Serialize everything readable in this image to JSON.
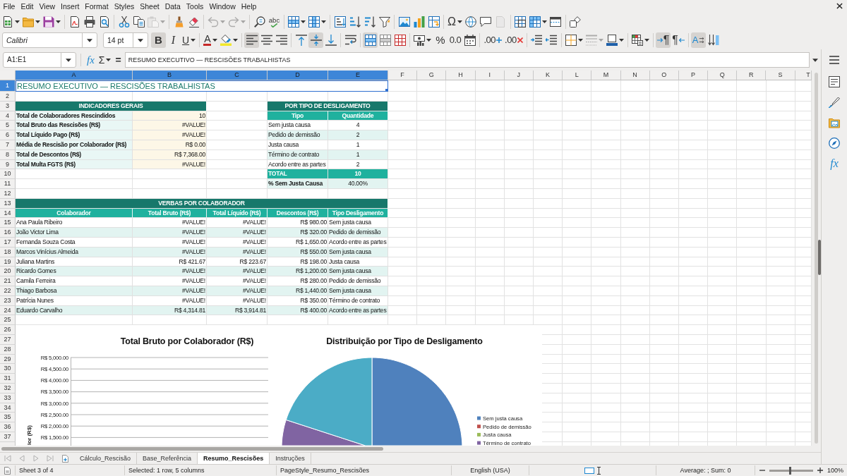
{
  "menu": [
    "File",
    "Edit",
    "View",
    "Insert",
    "Format",
    "Styles",
    "Sheet",
    "Data",
    "Tools",
    "Window",
    "Help"
  ],
  "standard_toolbar": {
    "groups": [
      {
        "items": [
          {
            "kind": "new",
            "dropdown": true,
            "disabled": false,
            "pressed": false
          },
          {
            "kind": "open",
            "dropdown": true,
            "disabled": false,
            "pressed": false
          },
          {
            "kind": "save",
            "dropdown": true,
            "disabled": false,
            "pressed": false
          }
        ]
      },
      {
        "items": [
          {
            "kind": "export_pdf",
            "dropdown": false,
            "disabled": false,
            "pressed": false
          },
          {
            "kind": "print",
            "dropdown": false,
            "disabled": false,
            "pressed": false
          },
          {
            "kind": "print_preview",
            "dropdown": false,
            "disabled": false,
            "pressed": false
          }
        ]
      },
      {
        "items": [
          {
            "kind": "cut",
            "dropdown": false,
            "disabled": false,
            "pressed": false
          },
          {
            "kind": "copy",
            "dropdown": false,
            "disabled": false,
            "pressed": false
          },
          {
            "kind": "paste",
            "dropdown": true,
            "disabled": true,
            "pressed": false
          }
        ]
      },
      {
        "items": [
          {
            "kind": "clone",
            "dropdown": false,
            "disabled": false,
            "pressed": false
          },
          {
            "kind": "clear_format",
            "dropdown": false,
            "disabled": false,
            "pressed": false
          }
        ]
      },
      {
        "items": [
          {
            "kind": "undo",
            "dropdown": true,
            "disabled": true,
            "pressed": false
          },
          {
            "kind": "redo",
            "dropdown": true,
            "disabled": true,
            "pressed": false
          }
        ]
      },
      {
        "items": [
          {
            "kind": "find_replace",
            "dropdown": false,
            "disabled": false,
            "pressed": false
          },
          {
            "kind": "spelling",
            "glyph": "abc",
            "dropdown": false,
            "disabled": false,
            "pressed": false
          }
        ]
      },
      {
        "items": [
          {
            "kind": "row",
            "dropdown": true,
            "disabled": false,
            "pressed": false
          },
          {
            "kind": "column",
            "dropdown": true,
            "disabled": false,
            "pressed": false
          }
        ]
      },
      {
        "items": [
          {
            "kind": "sort",
            "dropdown": false,
            "disabled": false,
            "pressed": false
          },
          {
            "kind": "sort_ascending",
            "dropdown": false,
            "disabled": false,
            "pressed": false
          },
          {
            "kind": "sort_descending",
            "dropdown": false,
            "disabled": false,
            "pressed": false
          },
          {
            "kind": "autofilter",
            "dropdown": false,
            "disabled": false,
            "pressed": false
          }
        ]
      },
      {
        "items": [
          {
            "kind": "image",
            "dropdown": false,
            "disabled": false,
            "pressed": false
          },
          {
            "kind": "chart",
            "dropdown": false,
            "disabled": false,
            "pressed": false
          },
          {
            "kind": "pivot_table",
            "dropdown": false,
            "disabled": false,
            "pressed": false
          }
        ]
      },
      {
        "items": [
          {
            "kind": "special_character",
            "glyph": "Ω",
            "dropdown": true,
            "disabled": false,
            "pressed": false
          },
          {
            "kind": "hyperlink",
            "dropdown": false,
            "disabled": false,
            "pressed": false
          },
          {
            "kind": "comment",
            "dropdown": false,
            "disabled": false,
            "pressed": false
          },
          {
            "kind": "header_footer",
            "dropdown": false,
            "disabled": true,
            "pressed": false
          }
        ]
      },
      {
        "items": [
          {
            "kind": "print_area",
            "dropdown": false,
            "disabled": false,
            "pressed": false
          },
          {
            "kind": "freeze",
            "dropdown": true,
            "disabled": false,
            "pressed": false
          },
          {
            "kind": "split_window",
            "dropdown": false,
            "disabled": false,
            "pressed": false
          }
        ]
      },
      {
        "items": [
          {
            "kind": "shapes",
            "dropdown": false,
            "disabled": false,
            "pressed": false
          }
        ]
      }
    ]
  },
  "formatting_toolbar": {
    "font_name": "Calibri",
    "font_size": "14 pt",
    "groups": [
      {
        "items": [
          {
            "kind": "bold",
            "glyph": "B",
            "dropdown": false,
            "disabled": false,
            "pressed": true
          },
          {
            "kind": "italic",
            "glyph": "I",
            "dropdown": false,
            "disabled": false,
            "pressed": false
          },
          {
            "kind": "underline",
            "glyph": "U",
            "dropdown": true,
            "disabled": false,
            "pressed": false
          }
        ]
      },
      {
        "items": [
          {
            "kind": "font_color",
            "glyph": "A",
            "dropdown": true,
            "disabled": false,
            "pressed": false
          },
          {
            "kind": "highlight",
            "dropdown": true,
            "disabled": false,
            "pressed": false
          }
        ]
      },
      {
        "items": [
          {
            "kind": "align_left",
            "dropdown": false,
            "disabled": false,
            "pressed": true
          },
          {
            "kind": "align_center",
            "dropdown": false,
            "disabled": false,
            "pressed": false
          },
          {
            "kind": "align_right",
            "dropdown": false,
            "disabled": false,
            "pressed": false
          }
        ]
      },
      {
        "items": [
          {
            "kind": "align_top",
            "dropdown": false,
            "disabled": false,
            "pressed": false
          },
          {
            "kind": "align_middle",
            "dropdown": false,
            "disabled": false,
            "pressed": true
          },
          {
            "kind": "align_bottom",
            "dropdown": false,
            "disabled": false,
            "pressed": false
          }
        ]
      },
      {
        "items": [
          {
            "kind": "wrap_text",
            "dropdown": false,
            "disabled": false,
            "pressed": false
          }
        ]
      },
      {
        "items": [
          {
            "kind": "merge_center",
            "dropdown": false,
            "disabled": false,
            "pressed": true
          },
          {
            "kind": "merge",
            "dropdown": false,
            "disabled": false,
            "pressed": false
          },
          {
            "kind": "unmerge",
            "dropdown": false,
            "disabled": false,
            "pressed": false
          }
        ]
      },
      {
        "items": [
          {
            "kind": "currency",
            "dropdown": true,
            "disabled": false,
            "pressed": false
          },
          {
            "kind": "percent",
            "glyph": "%",
            "dropdown": false,
            "disabled": false,
            "pressed": false
          },
          {
            "kind": "number",
            "glyph": "0.0",
            "dropdown": false,
            "disabled": false,
            "pressed": false
          },
          {
            "kind": "date",
            "dropdown": false,
            "disabled": false,
            "pressed": false
          }
        ]
      },
      {
        "items": [
          {
            "kind": "add_decimal",
            "glyph": ".00",
            "dropdown": false,
            "disabled": false,
            "pressed": false
          },
          {
            "kind": "delete_decimal",
            "glyph": ".00",
            "dropdown": false,
            "disabled": false,
            "pressed": false
          }
        ]
      },
      {
        "items": [
          {
            "kind": "indent",
            "dropdown": false,
            "disabled": false,
            "pressed": false
          },
          {
            "kind": "outdent",
            "dropdown": false,
            "disabled": false,
            "pressed": false
          }
        ]
      },
      {
        "items": [
          {
            "kind": "borders",
            "dropdown": true,
            "disabled": false,
            "pressed": false
          },
          {
            "kind": "border_style",
            "dropdown": true,
            "disabled": true,
            "pressed": false
          },
          {
            "kind": "border_color",
            "dropdown": true,
            "disabled": false,
            "pressed": false
          }
        ]
      },
      {
        "items": [
          {
            "kind": "conditional",
            "dropdown": true,
            "disabled": false,
            "pressed": false
          }
        ]
      },
      {
        "items": [
          {
            "kind": "ltr",
            "glyph": "¶",
            "dropdown": false,
            "disabled": false,
            "pressed": true
          },
          {
            "kind": "rtl",
            "glyph": "¶",
            "dropdown": false,
            "disabled": false,
            "pressed": false
          }
        ]
      },
      {
        "items": [
          {
            "kind": "text_horizontal",
            "glyph": "A",
            "dropdown": false,
            "disabled": false,
            "pressed": true
          },
          {
            "kind": "text_vertical",
            "dropdown": false,
            "disabled": false,
            "pressed": false
          }
        ]
      }
    ]
  },
  "formula_bar": {
    "name_box": "A1:E1",
    "tools": [
      {
        "kind": "function_wizard",
        "glyph": "fx",
        "dropdown": false
      },
      {
        "kind": "sum",
        "glyph": "Σ",
        "dropdown": true
      },
      {
        "kind": "formula",
        "glyph": "=",
        "dropdown": false
      }
    ],
    "content": "RESUMO EXECUTIVO — RESCISÕES TRABALHISTAS"
  },
  "sidebar": {
    "items": [
      {
        "kind": "properties"
      },
      {
        "kind": "styles"
      },
      {
        "kind": "gallery"
      },
      {
        "kind": "navigator"
      },
      {
        "kind": "functions",
        "glyph": "fx"
      }
    ]
  },
  "sheet": {
    "columns": [
      {
        "label": "A",
        "selected": true
      },
      {
        "label": "B",
        "selected": true
      },
      {
        "label": "C",
        "selected": true
      },
      {
        "label": "D",
        "selected": true
      },
      {
        "label": "E",
        "selected": true
      },
      {
        "label": "F",
        "selected": false
      },
      {
        "label": "G",
        "selected": false
      },
      {
        "label": "H",
        "selected": false
      },
      {
        "label": "I",
        "selected": false
      },
      {
        "label": "J",
        "selected": false
      },
      {
        "label": "K",
        "selected": false
      },
      {
        "label": "L",
        "selected": false
      },
      {
        "label": "M",
        "selected": false
      },
      {
        "label": "N",
        "selected": false
      },
      {
        "label": "O",
        "selected": false
      },
      {
        "label": "P",
        "selected": false
      },
      {
        "label": "Q",
        "selected": false
      },
      {
        "label": "R",
        "selected": false
      },
      {
        "label": "S",
        "selected": false
      },
      {
        "label": "T",
        "selected": false
      }
    ],
    "rows": [
      {
        "label": "1",
        "selected": true,
        "cells": {
          "A": {
            "kind": "title",
            "text": "RESUMO EXECUTIVO — RESCISÕES TRABALHISTAS"
          },
          "B": {
            "merged": true
          },
          "C": {
            "merged": true
          },
          "D": {
            "merged": true
          },
          "E": {
            "merged": true
          }
        }
      },
      {
        "label": "2",
        "selected": false
      },
      {
        "label": "3",
        "selected": false,
        "cells": {
          "A": {
            "kind": "section",
            "text": "INDICADORES GERAIS"
          },
          "B": {
            "merged": true
          },
          "D": {
            "kind": "section",
            "text": "POR TIPO DE DESLIGAMENTO"
          },
          "E": {
            "merged": true
          }
        }
      },
      {
        "label": "4",
        "selected": false,
        "cells": {
          "A": {
            "kind": "label",
            "text": "Total de Colaboradores Rescindidos"
          },
          "B": {
            "kind": "value",
            "text": "10"
          },
          "D": {
            "kind": "header",
            "text": "Tipo"
          },
          "E": {
            "kind": "header",
            "text": "Quantidade"
          }
        }
      },
      {
        "label": "5",
        "selected": false,
        "cells": {
          "A": {
            "kind": "label",
            "text": "Total Bruto das Rescisões (R$)"
          },
          "B": {
            "kind": "value",
            "text": "#VALUE!"
          },
          "D": {
            "kind": "text",
            "text": "Sem justa causa",
            "shaded": false
          },
          "E": {
            "kind": "count",
            "text": "4",
            "shaded": false
          }
        }
      },
      {
        "label": "6",
        "selected": false,
        "cells": {
          "A": {
            "kind": "label",
            "text": "Total Líquido Pago (R$)"
          },
          "B": {
            "kind": "value",
            "text": "#VALUE!"
          },
          "D": {
            "kind": "text",
            "text": "Pedido de demissão",
            "shaded": true
          },
          "E": {
            "kind": "count",
            "text": "2",
            "shaded": true
          }
        }
      },
      {
        "label": "7",
        "selected": false,
        "cells": {
          "A": {
            "kind": "label",
            "text": "Média de Rescisão por Colaborador (R$)"
          },
          "B": {
            "kind": "value",
            "text": "R$ 0.00"
          },
          "D": {
            "kind": "text",
            "text": "Justa causa",
            "shaded": false
          },
          "E": {
            "kind": "count",
            "text": "1",
            "shaded": false
          }
        }
      },
      {
        "label": "8",
        "selected": false,
        "cells": {
          "A": {
            "kind": "label",
            "text": "Total de Descontos (R$)"
          },
          "B": {
            "kind": "value",
            "text": "R$ 7,368.00"
          },
          "D": {
            "kind": "text",
            "text": "Término de contrato",
            "shaded": true
          },
          "E": {
            "kind": "count",
            "text": "1",
            "shaded": true
          }
        }
      },
      {
        "label": "9",
        "selected": false,
        "cells": {
          "A": {
            "kind": "label",
            "text": "Total Multa FGTS (R$)"
          },
          "B": {
            "kind": "value",
            "text": "#VALUE!"
          },
          "D": {
            "kind": "text",
            "text": "Acordo entre as partes",
            "shaded": false
          },
          "E": {
            "kind": "count",
            "text": "2",
            "shaded": false
          }
        }
      },
      {
        "label": "10",
        "selected": false,
        "cells": {
          "D": {
            "kind": "total_label",
            "text": "TOTAL"
          },
          "E": {
            "kind": "total_count",
            "text": "10"
          }
        }
      },
      {
        "label": "11",
        "selected": false,
        "cells": {
          "D": {
            "kind": "strong",
            "text": "% Sem Justa Causa",
            "shaded": true
          },
          "E": {
            "kind": "count",
            "text": "40.00%",
            "shaded": true
          }
        }
      },
      {
        "label": "12",
        "selected": false
      },
      {
        "label": "13",
        "selected": false,
        "cells": {
          "A": {
            "kind": "section",
            "text": "VERBAS POR COLABORADOR"
          },
          "B": {
            "merged": true
          },
          "C": {
            "merged": true
          },
          "D": {
            "merged": true
          },
          "E": {
            "merged": true
          }
        }
      },
      {
        "label": "14",
        "selected": false,
        "cells": {
          "A": {
            "kind": "header",
            "text": "Colaborador"
          },
          "B": {
            "kind": "header",
            "text": "Total Bruto (R$)"
          },
          "C": {
            "kind": "header",
            "text": "Total Líquido (R$)"
          },
          "D": {
            "kind": "header",
            "text": "Descontos (R$)"
          },
          "E": {
            "kind": "header",
            "text": "Tipo Desligamento"
          }
        }
      },
      {
        "label": "15",
        "selected": false,
        "cells": {
          "A": {
            "kind": "text",
            "text": "Ana Paula Ribeiro",
            "shaded": false
          },
          "B": {
            "kind": "number",
            "text": "#VALUE!",
            "shaded": false
          },
          "C": {
            "kind": "number",
            "text": "#VALUE!",
            "shaded": false
          },
          "D": {
            "kind": "number",
            "text": "R$ 980.00",
            "shaded": false
          },
          "E": {
            "kind": "text",
            "text": "Sem justa causa",
            "shaded": false
          }
        }
      },
      {
        "label": "16",
        "selected": false,
        "cells": {
          "A": {
            "kind": "text",
            "text": "João Victor Lima",
            "shaded": true
          },
          "B": {
            "kind": "number",
            "text": "#VALUE!",
            "shaded": true
          },
          "C": {
            "kind": "number",
            "text": "#VALUE!",
            "shaded": true
          },
          "D": {
            "kind": "number",
            "text": "R$ 320.00",
            "shaded": true
          },
          "E": {
            "kind": "text",
            "text": "Pedido de demissão",
            "shaded": true
          }
        }
      },
      {
        "label": "17",
        "selected": false,
        "cells": {
          "A": {
            "kind": "text",
            "text": "Fernanda Souza Costa",
            "shaded": false
          },
          "B": {
            "kind": "number",
            "text": "#VALUE!",
            "shaded": false
          },
          "C": {
            "kind": "number",
            "text": "#VALUE!",
            "shaded": false
          },
          "D": {
            "kind": "number",
            "text": "R$ 1,650.00",
            "shaded": false
          },
          "E": {
            "kind": "text",
            "text": "Acordo entre as partes",
            "shaded": false
          }
        }
      },
      {
        "label": "18",
        "selected": false,
        "cells": {
          "A": {
            "kind": "text",
            "text": "Marcos Vinícius Almeida",
            "shaded": true
          },
          "B": {
            "kind": "number",
            "text": "#VALUE!",
            "shaded": true
          },
          "C": {
            "kind": "number",
            "text": "#VALUE!",
            "shaded": true
          },
          "D": {
            "kind": "number",
            "text": "R$ 550.00",
            "shaded": true
          },
          "E": {
            "kind": "text",
            "text": "Sem justa causa",
            "shaded": true
          }
        }
      },
      {
        "label": "19",
        "selected": false,
        "cells": {
          "A": {
            "kind": "text",
            "text": "Juliana Martins",
            "shaded": false
          },
          "B": {
            "kind": "number",
            "text": "R$ 421.67",
            "shaded": false
          },
          "C": {
            "kind": "number",
            "text": "R$ 223.67",
            "shaded": false
          },
          "D": {
            "kind": "number",
            "text": "R$ 198.00",
            "shaded": false
          },
          "E": {
            "kind": "text",
            "text": "Justa causa",
            "shaded": false
          }
        }
      },
      {
        "label": "20",
        "selected": false,
        "cells": {
          "A": {
            "kind": "text",
            "text": "Ricardo Gomes",
            "shaded": true
          },
          "B": {
            "kind": "number",
            "text": "#VALUE!",
            "shaded": true
          },
          "C": {
            "kind": "number",
            "text": "#VALUE!",
            "shaded": true
          },
          "D": {
            "kind": "number",
            "text": "R$ 1,200.00",
            "shaded": true
          },
          "E": {
            "kind": "text",
            "text": "Sem justa causa",
            "shaded": true
          }
        }
      },
      {
        "label": "21",
        "selected": false,
        "cells": {
          "A": {
            "kind": "text",
            "text": "Camila Ferreira",
            "shaded": false
          },
          "B": {
            "kind": "number",
            "text": "#VALUE!",
            "shaded": false
          },
          "C": {
            "kind": "number",
            "text": "#VALUE!",
            "shaded": false
          },
          "D": {
            "kind": "number",
            "text": "R$ 280.00",
            "shaded": false
          },
          "E": {
            "kind": "text",
            "text": "Pedido de demissão",
            "shaded": false
          }
        }
      },
      {
        "label": "22",
        "selected": false,
        "cells": {
          "A": {
            "kind": "text",
            "text": "Thiago Barbosa",
            "shaded": true
          },
          "B": {
            "kind": "number",
            "text": "#VALUE!",
            "shaded": true
          },
          "C": {
            "kind": "number",
            "text": "#VALUE!",
            "shaded": true
          },
          "D": {
            "kind": "number",
            "text": "R$ 1,440.00",
            "shaded": true
          },
          "E": {
            "kind": "text",
            "text": "Sem justa causa",
            "shaded": true
          }
        }
      },
      {
        "label": "23",
        "selected": false,
        "cells": {
          "A": {
            "kind": "text",
            "text": "Patrícia Nunes",
            "shaded": false
          },
          "B": {
            "kind": "number",
            "text": "#VALUE!",
            "shaded": false
          },
          "C": {
            "kind": "number",
            "text": "#VALUE!",
            "shaded": false
          },
          "D": {
            "kind": "number",
            "text": "R$ 350.00",
            "shaded": false
          },
          "E": {
            "kind": "text",
            "text": "Término de contrato",
            "shaded": false
          }
        }
      },
      {
        "label": "24",
        "selected": false,
        "cells": {
          "A": {
            "kind": "text",
            "text": "Eduardo Carvalho",
            "shaded": true
          },
          "B": {
            "kind": "number",
            "text": "R$ 4,314.81",
            "shaded": true
          },
          "C": {
            "kind": "number",
            "text": "R$ 3,914.81",
            "shaded": true
          },
          "D": {
            "kind": "number",
            "text": "R$ 400.00",
            "shaded": true
          },
          "E": {
            "kind": "text",
            "text": "Acordo entre as partes",
            "shaded": true
          }
        }
      },
      {
        "label": "25",
        "selected": false
      },
      {
        "label": "26",
        "selected": false
      },
      {
        "label": "27",
        "selected": false
      },
      {
        "label": "28",
        "selected": false
      },
      {
        "label": "29",
        "selected": false
      },
      {
        "label": "30",
        "selected": false
      },
      {
        "label": "31",
        "selected": false
      },
      {
        "label": "32",
        "selected": false
      },
      {
        "label": "33",
        "selected": false
      },
      {
        "label": "34",
        "selected": false
      },
      {
        "label": "35",
        "selected": false
      },
      {
        "label": "36",
        "selected": false
      },
      {
        "label": "37",
        "selected": false
      }
    ],
    "charts": [
      {
        "kind": "bar",
        "title": "Total Bruto por Colaborador (R$)",
        "axis_title": "lor (R$)",
        "tick_labels": [
          "R$ 5,000.00",
          "R$ 4,500.00",
          "R$ 4,000.00",
          "R$ 3,500.00",
          "R$ 3,000.00",
          "R$ 2,500.00",
          "R$ 2,000.00",
          "R$ 1,500.00"
        ]
      },
      {
        "kind": "pie",
        "title": "Distribuição por Tipo de Desligamento",
        "legend": [
          {
            "label": "Sem justa causa",
            "color": "#4f81bd"
          },
          {
            "label": "Pedido de demissão",
            "color": "#c0504d"
          },
          {
            "label": "Justa causa",
            "color": "#9bbb59"
          },
          {
            "label": "Término de contrato",
            "color": "#8064a2"
          }
        ]
      }
    ]
  },
  "sheet_tabs": [
    {
      "label": "Cálculo_Rescisão",
      "selected": false
    },
    {
      "label": "Base_Referência",
      "selected": false
    },
    {
      "label": "Resumo_Rescisões",
      "selected": true
    },
    {
      "label": "Instruções",
      "selected": false
    }
  ],
  "status_bar": {
    "sheet_position": "Sheet 3 of 4",
    "selection_info": "Selected: 1 row, 5 columns",
    "page_style": "PageStyle_Resumo_Rescisões",
    "language": "English (USA)",
    "summary": "Average: ; Sum: 0",
    "zoom": {
      "level": 0.47,
      "label": "100%"
    }
  }
}
